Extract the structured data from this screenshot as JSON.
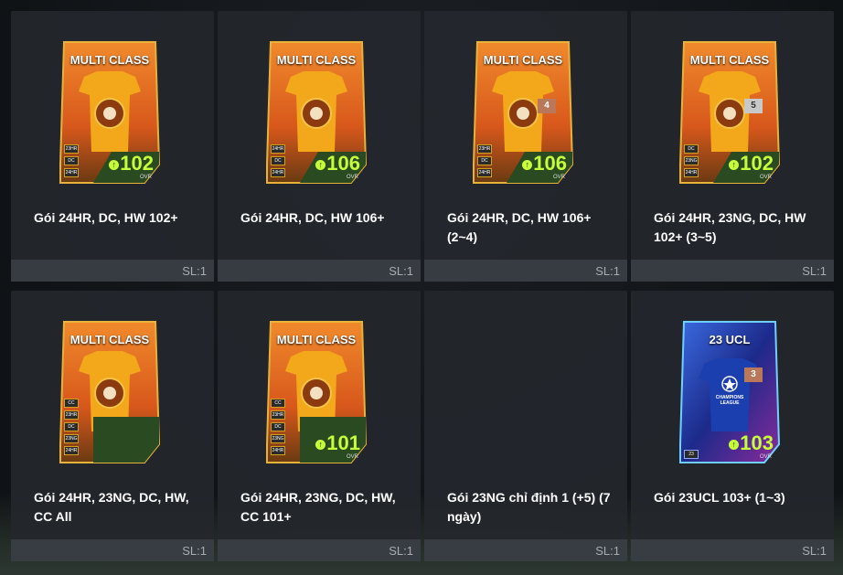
{
  "packs": [
    {
      "title": "Gói 24HR, DC, HW 102+",
      "qty": "SL:1",
      "card": {
        "name": "MULTI CLASS",
        "ovr": "102",
        "ovr_label": "OVR",
        "badges": [
          "23HR",
          "DC",
          "24HR"
        ],
        "grade": ""
      }
    },
    {
      "title": "Gói 24HR, DC, HW 106+",
      "qty": "SL:1",
      "card": {
        "name": "MULTI CLASS",
        "ovr": "106",
        "ovr_label": "OVR",
        "badges": [
          "24HR",
          "DC",
          "24HR"
        ],
        "grade": ""
      }
    },
    {
      "title": "Gói 24HR, DC, HW 106+ (2~4)",
      "qty": "SL:1",
      "card": {
        "name": "MULTI CLASS",
        "ovr": "106",
        "ovr_label": "OVR",
        "badges": [
          "23HR",
          "DC",
          "24HR"
        ],
        "grade": "4"
      }
    },
    {
      "title": "Gói 24HR, 23NG, DC, HW 102+ (3~5)",
      "qty": "SL:1",
      "card": {
        "name": "MULTI CLASS",
        "ovr": "102",
        "ovr_label": "OVR",
        "badges": [
          "DC",
          "23NG",
          "24HR"
        ],
        "grade": "5"
      }
    },
    {
      "title": "Gói 24HR, 23NG, DC, HW, CC All",
      "qty": "SL:1",
      "card": {
        "name": "MULTI CLASS",
        "ovr": "",
        "ovr_label": "",
        "badges": [
          "CC",
          "23HR",
          "DC",
          "23NG",
          "24HR"
        ],
        "grade": ""
      }
    },
    {
      "title": "Gói 24HR, 23NG, DC, HW, CC 101+",
      "qty": "SL:1",
      "card": {
        "name": "MULTI CLASS",
        "ovr": "101",
        "ovr_label": "OVR",
        "badges": [
          "CC",
          "23HR",
          "DC",
          "23NG",
          "24HR"
        ],
        "grade": ""
      }
    },
    {
      "title": "Gói 23NG chỉ định 1 (+5) (7 ngày)",
      "qty": "SL:1",
      "card": null
    },
    {
      "title": "Gói 23UCL 103+ (1~3)",
      "qty": "SL:1",
      "card": {
        "name": "23 UCL",
        "ovr": "103",
        "ovr_label": "OVR",
        "badges": [
          "23"
        ],
        "grade": "3",
        "ucl_text": "CHAMPIONS LEAGUE"
      }
    }
  ],
  "colors": {
    "ovr": "#c6ff3a",
    "card_orange": "#e9742a",
    "ucl_blue": "#1c3fb0"
  }
}
